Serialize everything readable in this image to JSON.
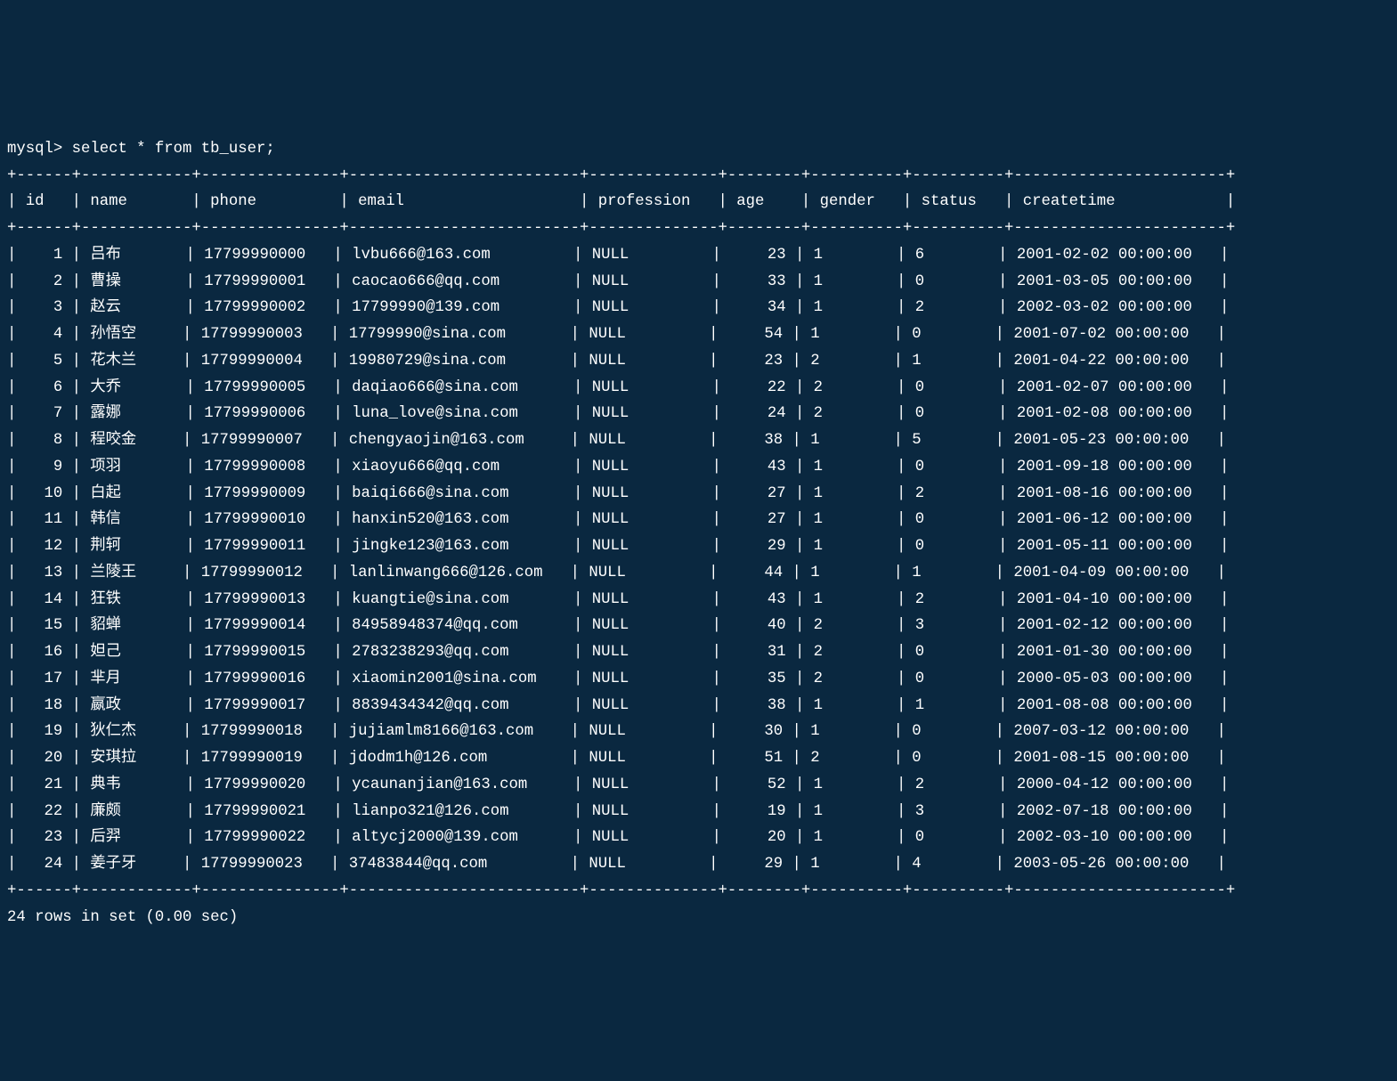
{
  "prompt": "mysql> ",
  "query": "select * from tb_user;",
  "columns": [
    "id",
    "name",
    "phone",
    "email",
    "profession",
    "age",
    "gender",
    "status",
    "createtime"
  ],
  "rows": [
    {
      "id": "1",
      "name": "吕布",
      "phone": "17799990000",
      "email": "lvbu666@163.com",
      "profession": "NULL",
      "age": "23",
      "gender": "1",
      "status": "6",
      "createtime": "2001-02-02 00:00:00"
    },
    {
      "id": "2",
      "name": "曹操",
      "phone": "17799990001",
      "email": "caocao666@qq.com",
      "profession": "NULL",
      "age": "33",
      "gender": "1",
      "status": "0",
      "createtime": "2001-03-05 00:00:00"
    },
    {
      "id": "3",
      "name": "赵云",
      "phone": "17799990002",
      "email": "17799990@139.com",
      "profession": "NULL",
      "age": "34",
      "gender": "1",
      "status": "2",
      "createtime": "2002-03-02 00:00:00"
    },
    {
      "id": "4",
      "name": "孙悟空",
      "phone": "17799990003",
      "email": "17799990@sina.com",
      "profession": "NULL",
      "age": "54",
      "gender": "1",
      "status": "0",
      "createtime": "2001-07-02 00:00:00"
    },
    {
      "id": "5",
      "name": "花木兰",
      "phone": "17799990004",
      "email": "19980729@sina.com",
      "profession": "NULL",
      "age": "23",
      "gender": "2",
      "status": "1",
      "createtime": "2001-04-22 00:00:00"
    },
    {
      "id": "6",
      "name": "大乔",
      "phone": "17799990005",
      "email": "daqiao666@sina.com",
      "profession": "NULL",
      "age": "22",
      "gender": "2",
      "status": "0",
      "createtime": "2001-02-07 00:00:00"
    },
    {
      "id": "7",
      "name": "露娜",
      "phone": "17799990006",
      "email": "luna_love@sina.com",
      "profession": "NULL",
      "age": "24",
      "gender": "2",
      "status": "0",
      "createtime": "2001-02-08 00:00:00"
    },
    {
      "id": "8",
      "name": "程咬金",
      "phone": "17799990007",
      "email": "chengyaojin@163.com",
      "profession": "NULL",
      "age": "38",
      "gender": "1",
      "status": "5",
      "createtime": "2001-05-23 00:00:00"
    },
    {
      "id": "9",
      "name": "项羽",
      "phone": "17799990008",
      "email": "xiaoyu666@qq.com",
      "profession": "NULL",
      "age": "43",
      "gender": "1",
      "status": "0",
      "createtime": "2001-09-18 00:00:00"
    },
    {
      "id": "10",
      "name": "白起",
      "phone": "17799990009",
      "email": "baiqi666@sina.com",
      "profession": "NULL",
      "age": "27",
      "gender": "1",
      "status": "2",
      "createtime": "2001-08-16 00:00:00"
    },
    {
      "id": "11",
      "name": "韩信",
      "phone": "17799990010",
      "email": "hanxin520@163.com",
      "profession": "NULL",
      "age": "27",
      "gender": "1",
      "status": "0",
      "createtime": "2001-06-12 00:00:00"
    },
    {
      "id": "12",
      "name": "荆轲",
      "phone": "17799990011",
      "email": "jingke123@163.com",
      "profession": "NULL",
      "age": "29",
      "gender": "1",
      "status": "0",
      "createtime": "2001-05-11 00:00:00"
    },
    {
      "id": "13",
      "name": "兰陵王",
      "phone": "17799990012",
      "email": "lanlinwang666@126.com",
      "profession": "NULL",
      "age": "44",
      "gender": "1",
      "status": "1",
      "createtime": "2001-04-09 00:00:00"
    },
    {
      "id": "14",
      "name": "狂铁",
      "phone": "17799990013",
      "email": "kuangtie@sina.com",
      "profession": "NULL",
      "age": "43",
      "gender": "1",
      "status": "2",
      "createtime": "2001-04-10 00:00:00"
    },
    {
      "id": "15",
      "name": "貂蝉",
      "phone": "17799990014",
      "email": "84958948374@qq.com",
      "profession": "NULL",
      "age": "40",
      "gender": "2",
      "status": "3",
      "createtime": "2001-02-12 00:00:00"
    },
    {
      "id": "16",
      "name": "妲己",
      "phone": "17799990015",
      "email": "2783238293@qq.com",
      "profession": "NULL",
      "age": "31",
      "gender": "2",
      "status": "0",
      "createtime": "2001-01-30 00:00:00"
    },
    {
      "id": "17",
      "name": "芈月",
      "phone": "17799990016",
      "email": "xiaomin2001@sina.com",
      "profession": "NULL",
      "age": "35",
      "gender": "2",
      "status": "0",
      "createtime": "2000-05-03 00:00:00"
    },
    {
      "id": "18",
      "name": "嬴政",
      "phone": "17799990017",
      "email": "8839434342@qq.com",
      "profession": "NULL",
      "age": "38",
      "gender": "1",
      "status": "1",
      "createtime": "2001-08-08 00:00:00"
    },
    {
      "id": "19",
      "name": "狄仁杰",
      "phone": "17799990018",
      "email": "jujiamlm8166@163.com",
      "profession": "NULL",
      "age": "30",
      "gender": "1",
      "status": "0",
      "createtime": "2007-03-12 00:00:00"
    },
    {
      "id": "20",
      "name": "安琪拉",
      "phone": "17799990019",
      "email": "jdodm1h@126.com",
      "profession": "NULL",
      "age": "51",
      "gender": "2",
      "status": "0",
      "createtime": "2001-08-15 00:00:00"
    },
    {
      "id": "21",
      "name": "典韦",
      "phone": "17799990020",
      "email": "ycaunanjian@163.com",
      "profession": "NULL",
      "age": "52",
      "gender": "1",
      "status": "2",
      "createtime": "2000-04-12 00:00:00"
    },
    {
      "id": "22",
      "name": "廉颇",
      "phone": "17799990021",
      "email": "lianpo321@126.com",
      "profession": "NULL",
      "age": "19",
      "gender": "1",
      "status": "3",
      "createtime": "2002-07-18 00:00:00"
    },
    {
      "id": "23",
      "name": "后羿",
      "phone": "17799990022",
      "email": "altycj2000@139.com",
      "profession": "NULL",
      "age": "20",
      "gender": "1",
      "status": "0",
      "createtime": "2002-03-10 00:00:00"
    },
    {
      "id": "24",
      "name": "姜子牙",
      "phone": "17799990023",
      "email": "37483844@qq.com",
      "profession": "NULL",
      "age": "29",
      "gender": "1",
      "status": "4",
      "createtime": "2003-05-26 00:00:00"
    }
  ],
  "footer": "24 rows in set (0.00 sec)",
  "widths": {
    "id": 4,
    "name": 10,
    "phone": 13,
    "email": 23,
    "profession": 12,
    "age": 6,
    "gender": 8,
    "status": 8,
    "createtime": 21
  }
}
